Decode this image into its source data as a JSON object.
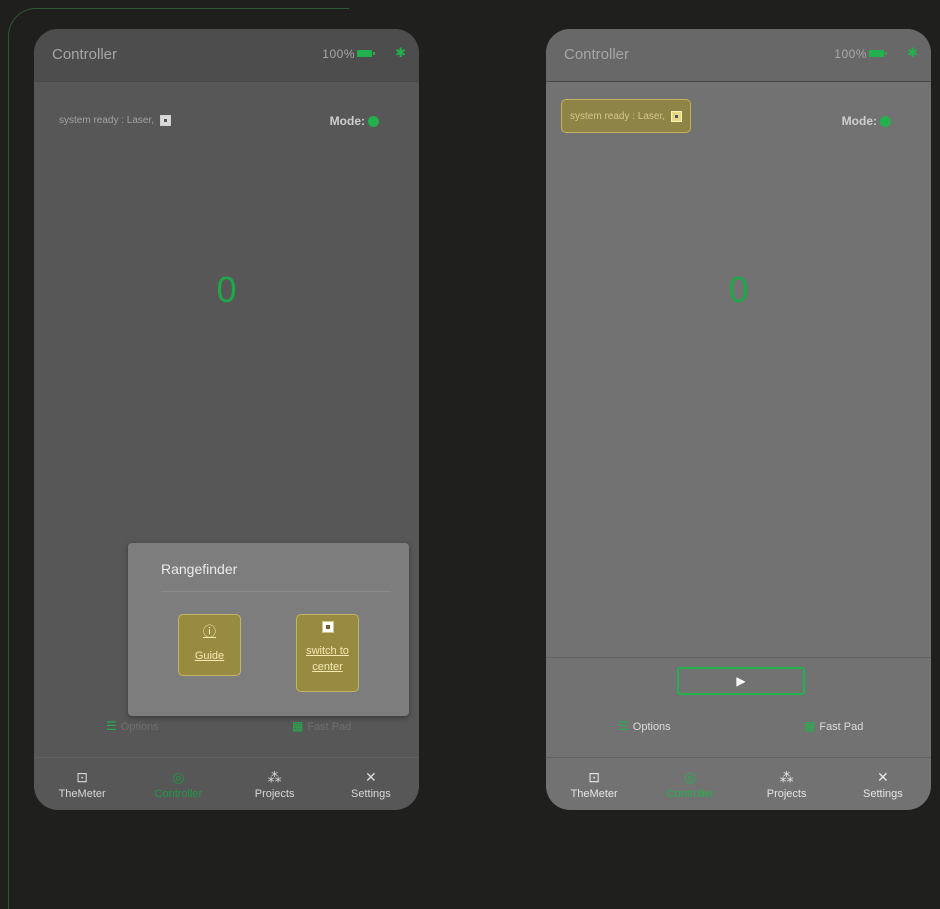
{
  "left_phone": {
    "header": {
      "title": "Controller",
      "battery": "100%",
      "bluetooth_icon": "bluetooth-icon"
    },
    "status": {
      "text": "system ready : Laser,"
    },
    "mode": {
      "label": "Mode:"
    },
    "reading": "0",
    "options": {
      "options_label": "Options",
      "fastpad_label": "Fast Pad"
    },
    "dialog": {
      "title": "Rangefinder",
      "guide_label": "Guide",
      "switch_label_line1": "switch to",
      "switch_label_line2": "center"
    },
    "nav": [
      {
        "label": "TheMeter",
        "icon": "meter-icon"
      },
      {
        "label": "Controller",
        "icon": "gamepad-icon"
      },
      {
        "label": "Projects",
        "icon": "grid-icon"
      },
      {
        "label": "Settings",
        "icon": "tools-icon"
      }
    ]
  },
  "right_phone": {
    "header": {
      "title": "Controller",
      "battery": "100%",
      "bluetooth_icon": "bluetooth-icon"
    },
    "status": {
      "text": "system ready : Laser,"
    },
    "mode": {
      "label": "Mode:"
    },
    "reading": "0",
    "options": {
      "options_label": "Options",
      "fastpad_label": "Fast Pad"
    },
    "nav": [
      {
        "label": "TheMeter",
        "icon": "meter-icon"
      },
      {
        "label": "Controller",
        "icon": "gamepad-icon"
      },
      {
        "label": "Projects",
        "icon": "grid-icon"
      },
      {
        "label": "Settings",
        "icon": "tools-icon"
      }
    ]
  },
  "colors": {
    "accent": "#22b14c",
    "highlight": "#978b42"
  }
}
